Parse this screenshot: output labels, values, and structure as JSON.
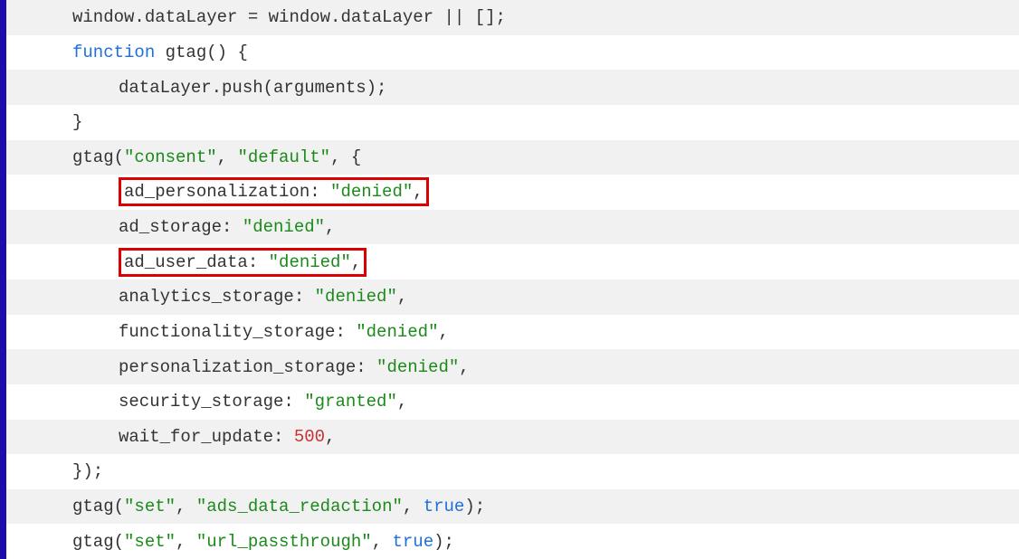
{
  "code": {
    "lines": [
      {
        "segments": [
          {
            "t": "window.dataLayer = window.dataLayer || [];",
            "c": "text"
          }
        ],
        "indent": 1
      },
      {
        "segments": [
          {
            "t": "function",
            "c": "kw"
          },
          {
            "t": " ",
            "c": "text"
          },
          {
            "t": "gtag",
            "c": "fn"
          },
          {
            "t": "() {",
            "c": "text"
          }
        ],
        "indent": 1
      },
      {
        "segments": [
          {
            "t": "dataLayer.push(arguments);",
            "c": "text"
          }
        ],
        "indent": 2
      },
      {
        "segments": [
          {
            "t": "}",
            "c": "text"
          }
        ],
        "indent": 1
      },
      {
        "segments": [
          {
            "t": "gtag(",
            "c": "text"
          },
          {
            "t": "\"consent\"",
            "c": "str"
          },
          {
            "t": ", ",
            "c": "text"
          },
          {
            "t": "\"default\"",
            "c": "str"
          },
          {
            "t": ", {",
            "c": "text"
          }
        ],
        "indent": 1
      },
      {
        "highlight": true,
        "segments": [
          {
            "t": "ad_personalization: ",
            "c": "text"
          },
          {
            "t": "\"denied\"",
            "c": "str"
          },
          {
            "t": ",",
            "c": "text"
          }
        ],
        "indent": 2
      },
      {
        "segments": [
          {
            "t": "ad_storage: ",
            "c": "text"
          },
          {
            "t": "\"denied\"",
            "c": "str"
          },
          {
            "t": ",",
            "c": "text"
          }
        ],
        "indent": 2
      },
      {
        "highlight": true,
        "segments": [
          {
            "t": "ad_user_data: ",
            "c": "text"
          },
          {
            "t": "\"denied\"",
            "c": "str"
          },
          {
            "t": ",",
            "c": "text"
          }
        ],
        "indent": 2
      },
      {
        "segments": [
          {
            "t": "analytics_storage: ",
            "c": "text"
          },
          {
            "t": "\"denied\"",
            "c": "str"
          },
          {
            "t": ",",
            "c": "text"
          }
        ],
        "indent": 2
      },
      {
        "segments": [
          {
            "t": "functionality_storage: ",
            "c": "text"
          },
          {
            "t": "\"denied\"",
            "c": "str"
          },
          {
            "t": ",",
            "c": "text"
          }
        ],
        "indent": 2
      },
      {
        "segments": [
          {
            "t": "personalization_storage: ",
            "c": "text"
          },
          {
            "t": "\"denied\"",
            "c": "str"
          },
          {
            "t": ",",
            "c": "text"
          }
        ],
        "indent": 2
      },
      {
        "segments": [
          {
            "t": "security_storage: ",
            "c": "text"
          },
          {
            "t": "\"granted\"",
            "c": "str"
          },
          {
            "t": ",",
            "c": "text"
          }
        ],
        "indent": 2
      },
      {
        "segments": [
          {
            "t": "wait_for_update: ",
            "c": "text"
          },
          {
            "t": "500",
            "c": "num"
          },
          {
            "t": ",",
            "c": "text"
          }
        ],
        "indent": 2
      },
      {
        "segments": [
          {
            "t": "});",
            "c": "text"
          }
        ],
        "indent": 1
      },
      {
        "segments": [
          {
            "t": "gtag(",
            "c": "text"
          },
          {
            "t": "\"set\"",
            "c": "str"
          },
          {
            "t": ", ",
            "c": "text"
          },
          {
            "t": "\"ads_data_redaction\"",
            "c": "str"
          },
          {
            "t": ", ",
            "c": "text"
          },
          {
            "t": "true",
            "c": "bool"
          },
          {
            "t": ");",
            "c": "text"
          }
        ],
        "indent": 1
      },
      {
        "segments": [
          {
            "t": "gtag(",
            "c": "text"
          },
          {
            "t": "\"set\"",
            "c": "str"
          },
          {
            "t": ", ",
            "c": "text"
          },
          {
            "t": "\"url_passthrough\"",
            "c": "str"
          },
          {
            "t": ", ",
            "c": "text"
          },
          {
            "t": "true",
            "c": "bool"
          },
          {
            "t": ");",
            "c": "text"
          }
        ],
        "indent": 1
      }
    ]
  }
}
